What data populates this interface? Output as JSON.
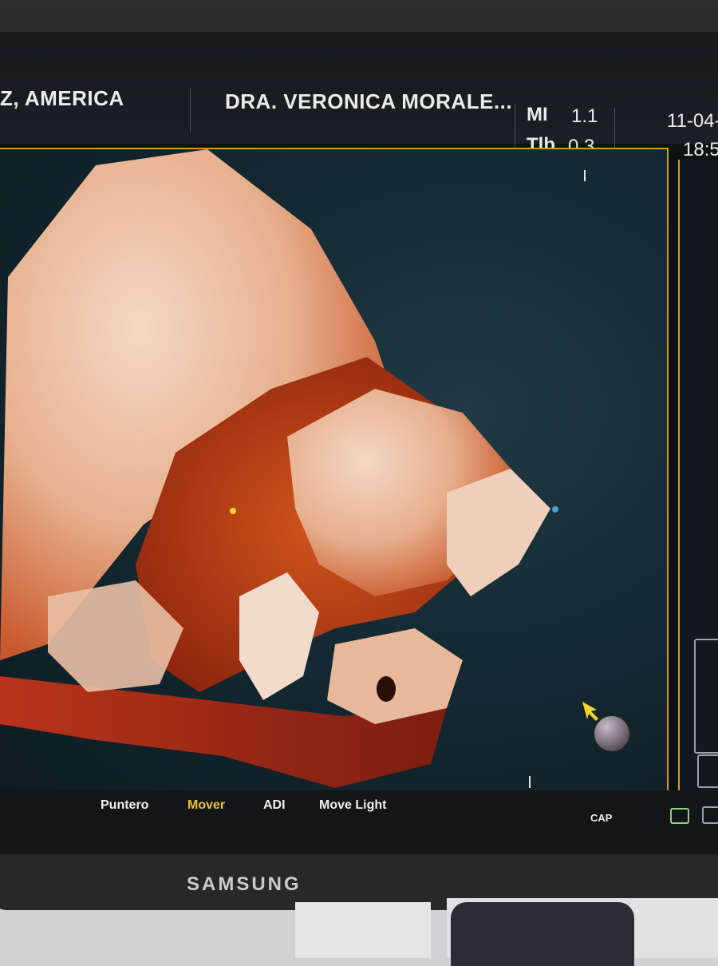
{
  "header": {
    "patient_name": "Z, AMERICA",
    "doctor_name": "DRA. VERONICA MORALE...",
    "mi_label": "MI",
    "mi_value": "1.1",
    "tib_label": "Tlb",
    "tib_value": "0.3",
    "date": "11-04-",
    "time": "18:5"
  },
  "menu": {
    "items": [
      {
        "label": "Puntero",
        "active": false
      },
      {
        "label": "Mover",
        "active": true
      },
      {
        "label": "ADI",
        "active": false
      },
      {
        "label": "Move Light",
        "active": false
      }
    ]
  },
  "status": {
    "cap_label": "CAP"
  },
  "monitor": {
    "brand": "SAMSUNG"
  },
  "colors": {
    "accent_border": "#d89a1e",
    "active_menu": "#f0c232",
    "render_skin": "#e8b89a"
  }
}
